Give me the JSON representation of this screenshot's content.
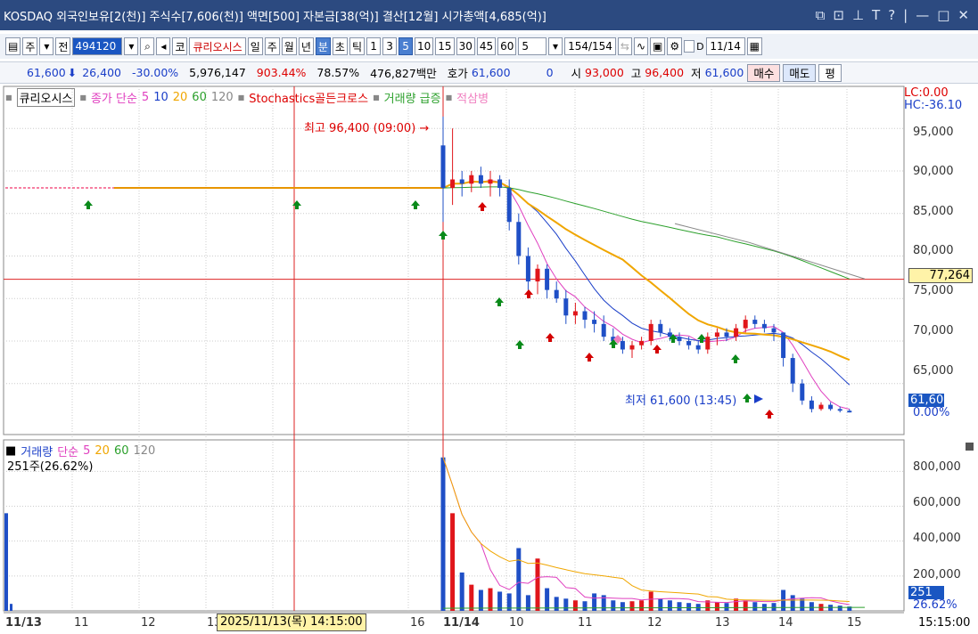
{
  "titlebar": {
    "text": "KOSDAQ 외국인보유[2(천)] 주식수[7,606(천)] 액면[500] 자본금[38(억)] 결산[12월] 시가총액[4,685(억)]"
  },
  "toolbar": {
    "code": "494120",
    "name": "큐리오시스",
    "market": "코",
    "btn_ju": "주",
    "btn_jeon": "전",
    "periods": [
      "일",
      "주",
      "월",
      "년",
      "분",
      "초",
      "틱"
    ],
    "selected_period": "분",
    "intervals": [
      "1",
      "3",
      "5",
      "10",
      "15",
      "30",
      "45",
      "60"
    ],
    "selected_interval": "5",
    "count_value": "5",
    "count_text": "154/154",
    "date": "11/14"
  },
  "quote": {
    "price": "61,600",
    "change": "26,400",
    "change_pct": "-30.00%",
    "volume": "5,976,147",
    "vol_ratio": "903.44%",
    "turnover": "78.57%",
    "amount": "476,827백만",
    "hoga_label": "호가",
    "hoga_value": "61,600",
    "hoga_qty": "0",
    "open_label": "시",
    "open": "93,000",
    "high_label": "고",
    "high": "96,400",
    "low_label": "저",
    "low": "61,600",
    "buy_btn": "매수",
    "sell_btn": "매도",
    "avg_btn": "평"
  },
  "legend": {
    "name": "큐리오시스",
    "ma_label": "종가 단순",
    "ma5": "5",
    "ma10": "10",
    "ma20": "20",
    "ma60": "60",
    "ma120": "120",
    "stoch": "Stochastics골든크로스",
    "vol_surge": "거래량 급증",
    "three_soldiers": "적삼병"
  },
  "lc": {
    "lc": "LC:0.00",
    "hc": "HC:-36.10"
  },
  "annotations": {
    "high": "최고 96,400 (09:00) →",
    "low": "최저 61,600 (13:45)"
  },
  "price_axis": [
    "95,000",
    "90,000",
    "85,000",
    "80,000",
    "75,000",
    "70,000",
    "65,000"
  ],
  "price_tags": {
    "crosshair": "77,264",
    "current": "61,600",
    "pct": "0.00%"
  },
  "volume": {
    "legend_name": "거래량",
    "legend_ma": "단순",
    "ma5": "5",
    "ma20": "20",
    "ma60": "60",
    "ma120": "120",
    "current": "251주(26.62%)",
    "axis": [
      "800,000",
      "600,000",
      "400,000",
      "200,000"
    ],
    "tag": "251",
    "tag_pct": "26.62%"
  },
  "x_axis": {
    "labels": [
      "11/13",
      "11",
      "12",
      "13",
      "16",
      "11/14",
      "10",
      "11",
      "12",
      "13",
      "14",
      "15"
    ],
    "crosshair_time": "2025/11/13(목) 14:15:00",
    "clock": "15:15:00"
  },
  "colors": {
    "up": "#e0161b",
    "down": "#1f4fc6",
    "ma5": "#e040c0",
    "ma10": "#1a3ec8",
    "ma20": "#f0a600",
    "ma60": "#2ca02c",
    "ma120": "#888888"
  },
  "chart_data": {
    "type": "candlestick",
    "price_ylim": [
      59000,
      99000
    ],
    "volume_ylim": [
      0,
      950000
    ],
    "candles_11_14": [
      [
        93000,
        96400,
        84000,
        88000
      ],
      [
        88000,
        95000,
        86000,
        89000
      ],
      [
        89000,
        90000,
        87000,
        88500
      ],
      [
        88500,
        90000,
        87500,
        89500
      ],
      [
        89500,
        90500,
        88000,
        88500
      ],
      [
        88500,
        90000,
        87000,
        89000
      ],
      [
        89000,
        89500,
        87000,
        88000
      ],
      [
        88000,
        89000,
        83000,
        84000
      ],
      [
        84000,
        85000,
        79000,
        80000
      ],
      [
        80000,
        81000,
        76000,
        77000
      ],
      [
        77000,
        79000,
        75500,
        78500
      ],
      [
        78500,
        79000,
        75000,
        76000
      ],
      [
        76000,
        77000,
        74500,
        75000
      ],
      [
        75000,
        76000,
        72000,
        73000
      ],
      [
        73000,
        74500,
        72000,
        73500
      ],
      [
        73500,
        74000,
        71500,
        72500
      ],
      [
        72500,
        73500,
        71000,
        72000
      ],
      [
        72000,
        73000,
        70000,
        70500
      ],
      [
        70500,
        71500,
        69500,
        70000
      ],
      [
        70000,
        70500,
        68500,
        69000
      ],
      [
        69000,
        70000,
        68000,
        69500
      ],
      [
        69500,
        70500,
        69000,
        70000
      ],
      [
        70000,
        72500,
        69500,
        72000
      ],
      [
        72000,
        72500,
        70500,
        71000
      ],
      [
        71000,
        71500,
        70000,
        70500
      ],
      [
        70500,
        71000,
        69500,
        70000
      ],
      [
        70000,
        70500,
        69000,
        69500
      ],
      [
        69500,
        70000,
        68500,
        69000
      ],
      [
        69000,
        71000,
        68500,
        70500
      ],
      [
        70500,
        71500,
        69500,
        71000
      ],
      [
        71000,
        71500,
        70000,
        70500
      ],
      [
        70500,
        72000,
        70000,
        71500
      ],
      [
        71500,
        73000,
        71000,
        72500
      ],
      [
        72500,
        73000,
        71500,
        72000
      ],
      [
        72000,
        72500,
        71000,
        71500
      ],
      [
        71500,
        72000,
        70000,
        71000
      ],
      [
        71000,
        71000,
        67000,
        68000
      ],
      [
        68000,
        68500,
        64000,
        65000
      ],
      [
        65000,
        65500,
        62500,
        63000
      ],
      [
        63000,
        63500,
        61600,
        62000
      ],
      [
        62000,
        62800,
        61800,
        62500
      ],
      [
        62500,
        62800,
        61800,
        62000
      ],
      [
        62000,
        62300,
        61600,
        61800
      ],
      [
        61800,
        62000,
        61600,
        61600
      ]
    ],
    "prev_close_line": 88000,
    "crosshair_price": 77264,
    "volume_bars_11_14": [
      880000,
      560000,
      220000,
      150000,
      120000,
      130000,
      110000,
      100000,
      360000,
      90000,
      300000,
      130000,
      80000,
      70000,
      60000,
      55000,
      100000,
      90000,
      60000,
      50000,
      55000,
      60000,
      110000,
      70000,
      60000,
      50000,
      45000,
      40000,
      60000,
      50000,
      45000,
      70000,
      60000,
      50000,
      40000,
      45000,
      120000,
      90000,
      70000,
      50000,
      40000,
      35000,
      30000,
      25000
    ],
    "signals": {
      "up_green": [
        99,
        333,
        466,
        497,
        560,
        583,
        688,
        755,
        787,
        825,
        838
      ],
      "up_red": [
        541,
        593,
        617,
        661,
        737,
        863
      ],
      "pink": [
        693
      ]
    }
  }
}
